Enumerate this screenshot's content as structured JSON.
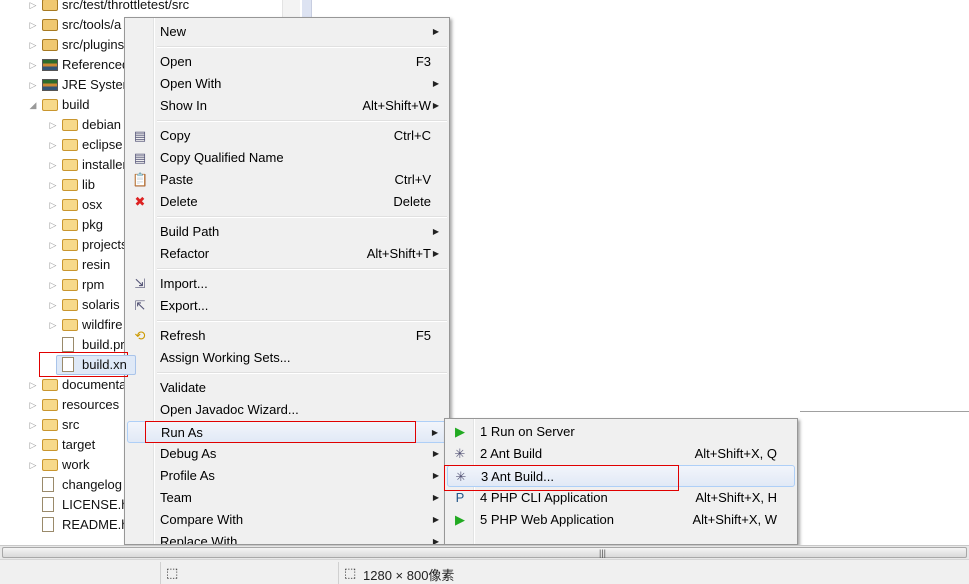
{
  "tree": [
    {
      "label": "src/test/throttletest/src",
      "level": 1,
      "icon": "package-folder-icon",
      "arrow": "collapsed"
    },
    {
      "label": "src/tools/a",
      "level": 1,
      "icon": "package-folder-icon",
      "arrow": "collapsed"
    },
    {
      "label": "src/plugins",
      "level": 1,
      "icon": "package-folder-icon",
      "arrow": "collapsed"
    },
    {
      "label": "Referenced",
      "level": 1,
      "icon": "library-icon",
      "arrow": "collapsed"
    },
    {
      "label": "JRE System",
      "level": 1,
      "icon": "library-icon",
      "arrow": "collapsed"
    },
    {
      "label": "build",
      "level": 1,
      "icon": "folder-icon",
      "arrow": "expanded"
    },
    {
      "label": "debian",
      "level": 2,
      "icon": "folder-icon",
      "arrow": "collapsed"
    },
    {
      "label": "eclipse",
      "level": 2,
      "icon": "folder-icon",
      "arrow": "collapsed"
    },
    {
      "label": "installer",
      "level": 2,
      "icon": "folder-icon",
      "arrow": "collapsed"
    },
    {
      "label": "lib",
      "level": 2,
      "icon": "folder-icon",
      "arrow": "collapsed"
    },
    {
      "label": "osx",
      "level": 2,
      "icon": "folder-icon",
      "arrow": "collapsed"
    },
    {
      "label": "pkg",
      "level": 2,
      "icon": "folder-icon",
      "arrow": "collapsed"
    },
    {
      "label": "projects",
      "level": 2,
      "icon": "folder-icon",
      "arrow": "collapsed"
    },
    {
      "label": "resin",
      "level": 2,
      "icon": "folder-icon",
      "arrow": "collapsed"
    },
    {
      "label": "rpm",
      "level": 2,
      "icon": "folder-icon",
      "arrow": "collapsed"
    },
    {
      "label": "solaris",
      "level": 2,
      "icon": "folder-icon",
      "arrow": "collapsed"
    },
    {
      "label": "wildfire",
      "level": 2,
      "icon": "folder-icon",
      "arrow": "collapsed"
    },
    {
      "label": "build.pr",
      "level": 2,
      "icon": "properties-file-icon",
      "arrow": "none"
    },
    {
      "label": "build.xn",
      "level": 2,
      "icon": "ant-xml-file-icon",
      "arrow": "none",
      "selected": true
    },
    {
      "label": "documenta",
      "level": 1,
      "icon": "folder-icon",
      "arrow": "collapsed"
    },
    {
      "label": "resources",
      "level": 1,
      "icon": "folder-icon",
      "arrow": "collapsed"
    },
    {
      "label": "src",
      "level": 1,
      "icon": "warning-folder-icon",
      "arrow": "collapsed"
    },
    {
      "label": "target",
      "level": 1,
      "icon": "folder-icon",
      "arrow": "collapsed"
    },
    {
      "label": "work",
      "level": 1,
      "icon": "folder-icon",
      "arrow": "collapsed"
    },
    {
      "label": "changelog",
      "level": 1,
      "icon": "html-file-icon",
      "arrow": "none"
    },
    {
      "label": "LICENSE.ht",
      "level": 1,
      "icon": "html-file-icon",
      "arrow": "none"
    },
    {
      "label": "README.ht",
      "level": 1,
      "icon": "html-file-icon",
      "arrow": "none"
    }
  ],
  "context_menu": [
    {
      "label": "New",
      "shortcut": "",
      "submenu": true
    },
    {
      "sep": true
    },
    {
      "label": "Open",
      "shortcut": "F3"
    },
    {
      "label": "Open With",
      "shortcut": "",
      "submenu": true
    },
    {
      "label": "Show In",
      "shortcut": "Alt+Shift+W",
      "submenu": true
    },
    {
      "sep": true
    },
    {
      "label": "Copy",
      "shortcut": "Ctrl+C",
      "icon": "copy-icon"
    },
    {
      "label": "Copy Qualified Name",
      "shortcut": "",
      "icon": "copy-qualified-name-icon"
    },
    {
      "label": "Paste",
      "shortcut": "Ctrl+V",
      "icon": "paste-icon"
    },
    {
      "label": "Delete",
      "shortcut": "Delete",
      "icon": "delete-icon"
    },
    {
      "sep": true
    },
    {
      "label": "Build Path",
      "shortcut": "",
      "submenu": true
    },
    {
      "label": "Refactor",
      "shortcut": "Alt+Shift+T",
      "submenu": true
    },
    {
      "sep": true
    },
    {
      "label": "Import...",
      "shortcut": "",
      "icon": "import-icon"
    },
    {
      "label": "Export...",
      "shortcut": "",
      "icon": "export-icon"
    },
    {
      "sep": true
    },
    {
      "label": "Refresh",
      "shortcut": "F5",
      "icon": "refresh-icon"
    },
    {
      "label": "Assign Working Sets...",
      "shortcut": ""
    },
    {
      "sep": true
    },
    {
      "label": "Validate",
      "shortcut": ""
    },
    {
      "label": "Open Javadoc Wizard...",
      "shortcut": ""
    },
    {
      "label": "Run As",
      "shortcut": "",
      "submenu": true,
      "highlighted": true
    },
    {
      "label": "Debug As",
      "shortcut": "",
      "submenu": true
    },
    {
      "label": "Profile As",
      "shortcut": "",
      "submenu": true
    },
    {
      "label": "Team",
      "shortcut": "",
      "submenu": true
    },
    {
      "label": "Compare With",
      "shortcut": "",
      "submenu": true
    },
    {
      "label": "Replace With",
      "shortcut": "",
      "submenu": true
    }
  ],
  "run_as_submenu": [
    {
      "label": "1 Run on Server",
      "shortcut": "",
      "icon": "run-on-server-icon"
    },
    {
      "label": "2 Ant Build",
      "shortcut": "Alt+Shift+X, Q",
      "icon": "ant-icon"
    },
    {
      "label": "3 Ant Build...",
      "shortcut": "",
      "icon": "ant-icon",
      "highlighted": true
    },
    {
      "label": "4 PHP CLI Application",
      "shortcut": "Alt+Shift+X, H",
      "icon": "php-cli-icon"
    },
    {
      "label": "5 PHP Web Application",
      "shortcut": "Alt+Shift+X, W",
      "icon": "php-web-icon"
    }
  ],
  "status_bar": {
    "selection_icon": "selection-icon",
    "dimensions_icon": "dimensions-icon",
    "dimensions": "1280 × 800像素"
  },
  "colors": {
    "highlight_box": "#e00000",
    "menu_bg": "#f0f0f0",
    "hover_border": "#aecff7"
  }
}
